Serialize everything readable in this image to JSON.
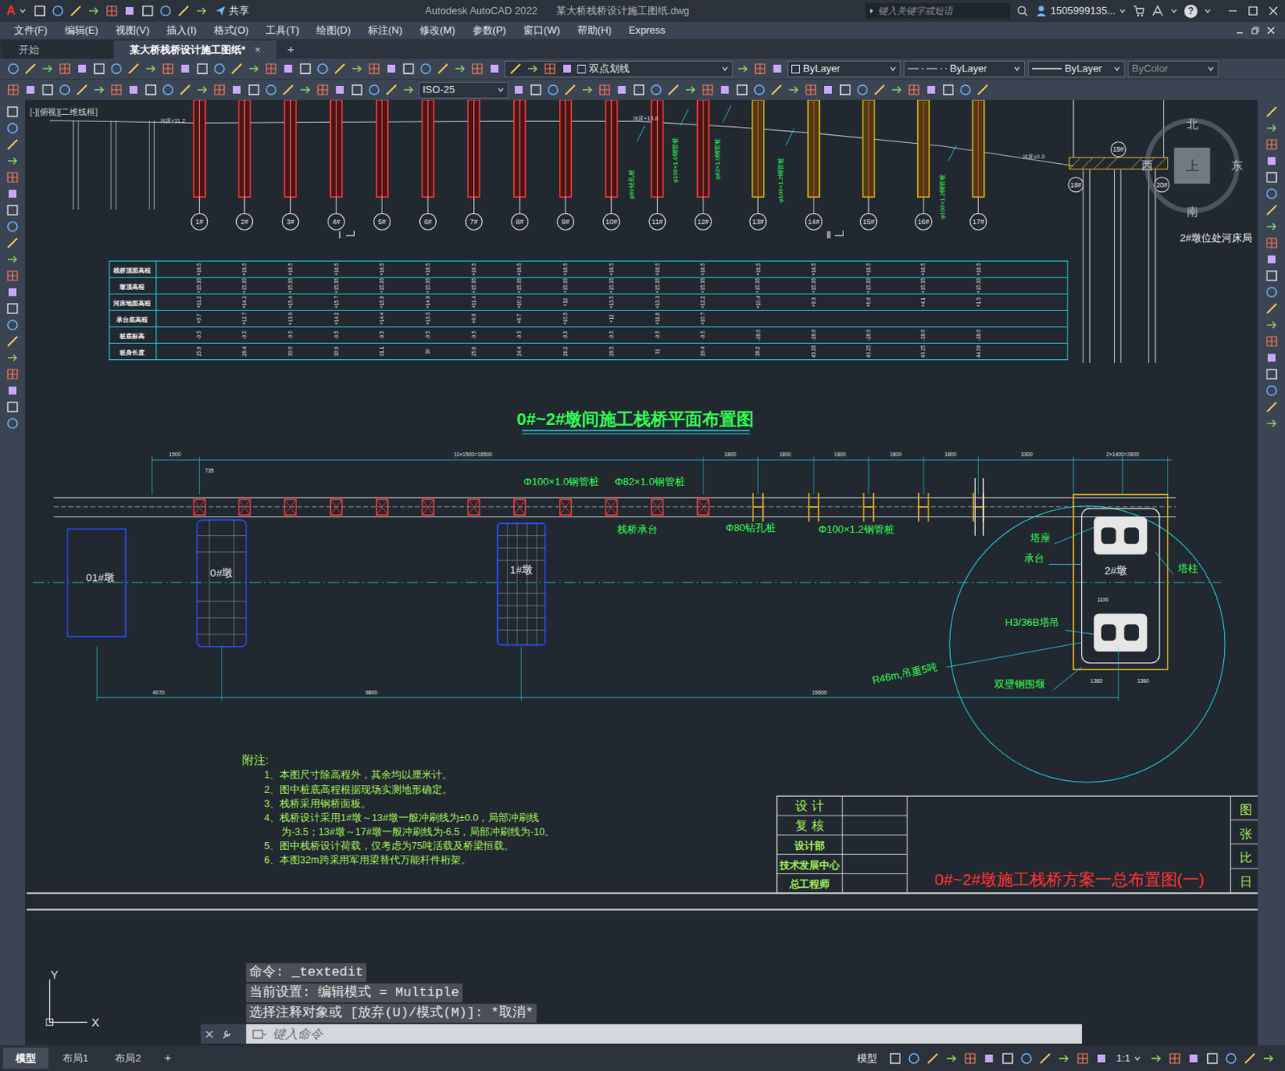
{
  "window": {
    "logo": "A",
    "app": "Autodesk AutoCAD 2022",
    "file": "某大桥栈桥设计施工图纸.dwg",
    "share": "共享",
    "search_placeholder": "键入关键字或短语",
    "user": "1505999135...",
    "help": "?"
  },
  "menu": [
    "文件(F)",
    "编辑(E)",
    "视图(V)",
    "插入(I)",
    "格式(O)",
    "工具(T)",
    "绘图(D)",
    "标注(N)",
    "修改(M)",
    "参数(P)",
    "窗口(W)",
    "帮助(H)",
    "Express"
  ],
  "doc_tabs": [
    {
      "label": "开始",
      "selected": false
    },
    {
      "label": "某大桥栈桥设计施工图纸*",
      "selected": true
    }
  ],
  "doc_tab_close": "×",
  "doc_tab_new": "+",
  "toolbar": {
    "layer": "双点划线",
    "color": "ByLayer",
    "linetype": "ByLayer",
    "lineweight": "ByLayer",
    "plotstyle": {
      "label": "ByColor",
      "disabled": true
    },
    "dimstyle": "ISO-25"
  },
  "viewport_label": "[-][俯视][二维线框]",
  "drawing": {
    "elevation_labels": [
      "河床+11.2",
      "河床+13.8",
      "河床±0.0"
    ],
    "pile_callouts": [
      "φ80钻孔桩",
      "φ100×1.0钢管桩",
      "φ82×1.0钢管桩",
      "φ100×1.2钢管桩",
      "φ100×1.2钢管桩"
    ],
    "piles": [
      "1#",
      "2#",
      "3#",
      "4#",
      "5#",
      "6#",
      "7#",
      "8#",
      "9#",
      "10#",
      "11#",
      "12#",
      "13#",
      "14#",
      "15#",
      "16#",
      "17#"
    ],
    "tower_piles": [
      "18#",
      "19#",
      "20#"
    ],
    "sections": [
      "Ⅰ",
      "Ⅱ"
    ],
    "compass": {
      "north": "北",
      "south": "南",
      "east": "东",
      "west": "西",
      "top": "上"
    },
    "note_tag": "2#墩位处河床局",
    "table": {
      "rows": [
        {
          "label": "栈桥顶面高程",
          "values": [
            "+16.5",
            "+16.5",
            "+16.5",
            "+16.5",
            "+16.5",
            "+16.5",
            "+16.5",
            "+16.5",
            "+16.5",
            "+16.5",
            "+16.5",
            "+16.5",
            "+16.5",
            "+16.5",
            "+16.5",
            "+16.5",
            "+16.5"
          ]
        },
        {
          "label": "墩顶高程",
          "values": [
            "+15.35",
            "+15.35",
            "+15.35",
            "+15.35",
            "+15.35",
            "+15.35",
            "+15.35",
            "+15.35",
            "+15.35",
            "+15.35",
            "+15.35",
            "+15.35",
            "+15.35",
            "+15.35",
            "+15.35",
            "+15.35",
            "+15.35"
          ]
        },
        {
          "label": "河床地面高程",
          "values": [
            "+11.2",
            "+14.2",
            "+15.4",
            "+15.7",
            "+15.9",
            "+14.8",
            "+11.4",
            "+10.2",
            "+12",
            "+13.5",
            "+13.3",
            "+12.2",
            "+10.4",
            "+9.3",
            "+6.8",
            "+4.1",
            "+1.5"
          ]
        },
        {
          "label": "承台底高程",
          "values": [
            "+9.7",
            "+12.7",
            "+13.9",
            "+14.2",
            "+14.4",
            "+13.3",
            "+9.9",
            "+8.7",
            "+10.5",
            "+12",
            "+11.8",
            "+10.7"
          ]
        },
        {
          "label": "桩底标高",
          "values": [
            "-9.5",
            "-9.5",
            "-9.5",
            "-9.5",
            "-9.5",
            "-9.5",
            "-9.5",
            "-9.5",
            "-9.5",
            "-9.5",
            "-9.5",
            "-9.5",
            "-28.0",
            "-28.0",
            "-28.0",
            "-28.0",
            "-28.0"
          ]
        },
        {
          "label": "桩身长度",
          "values": [
            "25.9",
            "28.4",
            "30.0",
            "30.9",
            "31.1",
            "30",
            "25.6",
            "24.4",
            "26.2",
            "28.5",
            "31",
            "29.4",
            "38.2",
            "43.35",
            "43.25",
            "43.25",
            "44.09"
          ]
        }
      ]
    },
    "plan": {
      "title": "0#~2#墩间施工栈桥平面布置图",
      "dims_top": [
        "1500",
        "11×1500=16500",
        "1800",
        "1800",
        "1800",
        "1800",
        "1800",
        "3300",
        "2×1400=2800",
        "735"
      ],
      "labels": [
        "Φ100×1.0钢管桩",
        "Φ82×1.0钢管桩",
        "栈桥承台",
        "Φ80钻孔桩",
        "Φ100×1.2钢管桩"
      ],
      "piers": [
        "01#墩",
        "0#墩",
        "1#墩",
        "2#墩"
      ],
      "tower_labels": [
        "塔座",
        "承台",
        "塔柱",
        "H3/36B塔吊",
        "R46m,吊重5吨",
        "双壁钢围堰"
      ],
      "tower_dims": [
        "1100",
        "1360",
        "1360"
      ],
      "dims_bottom": [
        "4070",
        "9800",
        "19600"
      ]
    },
    "notes": {
      "heading": "附注:",
      "lines": [
        {
          "text": "1、本图尺寸除高程外，其余均以厘米计。",
          "kind": "item"
        },
        {
          "text": "2、图中桩底高程根据现场实测地形确定。",
          "kind": "item"
        },
        {
          "text": "3、栈桥采用钢桥面板。",
          "kind": "item"
        },
        {
          "text": "4、栈桥设计采用1#墩～13#墩一般冲刷线为±0.0，局部冲刷线",
          "kind": "item"
        },
        {
          "text": "为-3.5；13#墩～17#墩一般冲刷线为-6.5，局部冲刷线为-10。",
          "kind": "continuation"
        },
        {
          "text": "5、图中栈桥设计荷载，仅考虑为75吨活载及桥梁恒载。",
          "kind": "item"
        },
        {
          "text": "6、本图32m跨采用军用梁替代万能杆件桁架。",
          "kind": "item"
        }
      ]
    },
    "title_block": {
      "roles": [
        "设 计",
        "复 核",
        "设计部",
        "技术发展中心",
        "总工程师"
      ],
      "title": "0#~2#墩施工栈桥方案一总布置图(一)",
      "fields": [
        "图",
        "张",
        "比",
        "日"
      ]
    },
    "ucs": {
      "x": "X",
      "y": "Y"
    }
  },
  "command_line": {
    "history": [
      "命令: _textedit",
      "当前设置: 编辑模式 = Multiple",
      "选择注释对象或 [放弃(U)/模式(M)]: *取消*"
    ],
    "placeholder": "键入命令"
  },
  "layout_tabs": [
    {
      "label": "模型",
      "selected": true
    },
    {
      "label": "布局1",
      "selected": false
    },
    {
      "label": "布局2",
      "selected": false
    }
  ],
  "layout_tab_new": "+",
  "status_bar": {
    "space": "模型",
    "scale": "1:1"
  }
}
